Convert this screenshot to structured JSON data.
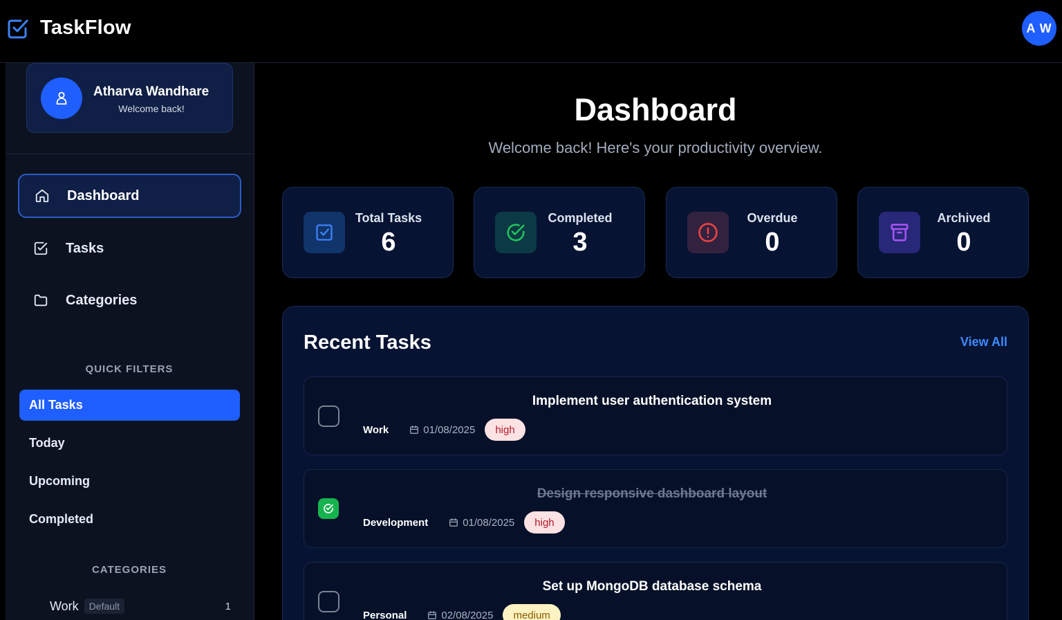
{
  "app": {
    "name": "TaskFlow",
    "user_initials": "A W"
  },
  "profile": {
    "name": "Atharva Wandhare",
    "subtitle": "Welcome back!"
  },
  "nav": [
    {
      "label": "Dashboard",
      "icon": "home-icon",
      "active": true
    },
    {
      "label": "Tasks",
      "icon": "checkbox-icon",
      "active": false
    },
    {
      "label": "Categories",
      "icon": "folder-icon",
      "active": false
    }
  ],
  "quick_filters": {
    "title": "QUICK FILTERS",
    "items": [
      "All Tasks",
      "Today",
      "Upcoming",
      "Completed"
    ],
    "active": "All Tasks"
  },
  "categories": {
    "title": "CATEGORIES",
    "items": [
      {
        "name": "Work",
        "badge": "Default",
        "count": "1"
      }
    ]
  },
  "main": {
    "title": "Dashboard",
    "subtitle": "Welcome back! Here's your productivity overview."
  },
  "stats": [
    {
      "label": "Total Tasks",
      "value": "6",
      "icon": "checkbox-icon",
      "color": "#3b82f6",
      "bg": "#11346b"
    },
    {
      "label": "Completed",
      "value": "3",
      "icon": "check-circle-icon",
      "color": "#22c55e",
      "bg": "#0b3a44"
    },
    {
      "label": "Overdue",
      "value": "0",
      "icon": "alert-circle-icon",
      "color": "#ef4444",
      "bg": "#33223f"
    },
    {
      "label": "Archived",
      "value": "0",
      "icon": "archive-icon",
      "color": "#a855f7",
      "bg": "#282878"
    }
  ],
  "recent": {
    "title": "Recent Tasks",
    "view_all": "View All",
    "tasks": [
      {
        "title": "Implement user authentication system",
        "category": "Work",
        "date": "01/08/2025",
        "priority": "high",
        "done": false
      },
      {
        "title": "Design responsive dashboard layout",
        "category": "Development",
        "date": "01/08/2025",
        "priority": "high",
        "done": true
      },
      {
        "title": "Set up MongoDB database schema",
        "category": "Personal",
        "date": "02/08/2025",
        "priority": "medium",
        "done": false
      }
    ]
  },
  "colors": {
    "accent": "#1f5eff",
    "link": "#3d8bff",
    "success": "#16b34f"
  }
}
